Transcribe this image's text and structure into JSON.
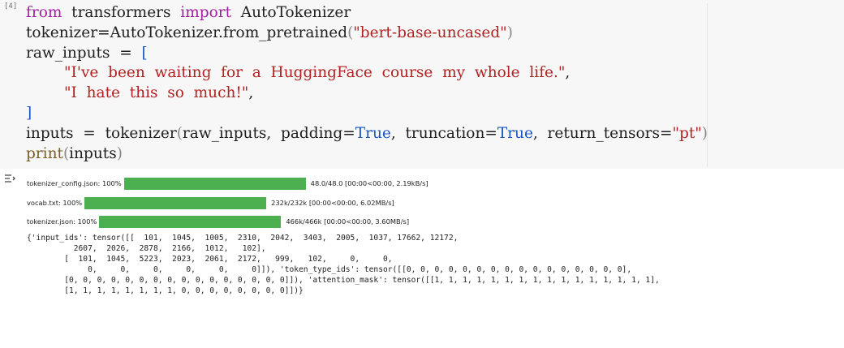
{
  "cell": {
    "execution_count": "[4]",
    "code": {
      "line1": {
        "from": "from",
        "module": "transformers",
        "import": "import",
        "name": "AutoTokenizer"
      },
      "line2": {
        "lhs": "tokenizer=AutoTokenizer.from_pretrained",
        "arg": "\"bert-base-uncased\""
      },
      "line3": {
        "lhs": "raw_inputs",
        "eq": "=",
        "bracket": "["
      },
      "line4": {
        "str": "\"I've  been  waiting  for  a  HuggingFace  course  my  whole  life.\"",
        "comma": ","
      },
      "line5": {
        "str": "\"I  hate  this  so  much!\"",
        "comma": ","
      },
      "line6": {
        "bracket": "]"
      },
      "line7": {
        "lhs": "inputs",
        "eq": "=",
        "call": "tokenizer",
        "args_a": "raw_inputs,  padding=",
        "true1": "True",
        "args_b": ",  truncation=",
        "true2": "True",
        "args_c": ",  return_tensors=",
        "pt": "\"pt\""
      },
      "line8": {
        "fn": "print",
        "arg": "inputs"
      }
    }
  },
  "output": {
    "icon": "output-toggle-icon",
    "progress_bars": [
      {
        "desc": "tokenizer_config.json: 100%",
        "stats": "48.0/48.0 [00:00<00:00, 2.19kB/s]",
        "progress": 1.0
      },
      {
        "desc": "vocab.txt: 100%",
        "stats": "232k/232k [00:00<00:00, 6.02MB/s]",
        "progress": 1.0
      },
      {
        "desc": "tokenizer.json: 100%",
        "stats": "466k/466k [00:00<00:00, 3.60MB/s]",
        "progress": 1.0
      }
    ],
    "text": "{'input_ids': tensor([[  101,  1045,  1005,  2310,  2042,  3403,  2005,  1037, 17662, 12172,\n          2607,  2026,  2878,  2166,  1012,   102],\n        [  101,  1045,  5223,  2023,  2061,  2172,   999,   102,     0,     0,\n             0,     0,     0,     0,     0,     0]]), 'token_type_ids': tensor([[0, 0, 0, 0, 0, 0, 0, 0, 0, 0, 0, 0, 0, 0, 0, 0],\n        [0, 0, 0, 0, 0, 0, 0, 0, 0, 0, 0, 0, 0, 0, 0, 0]]), 'attention_mask': tensor([[1, 1, 1, 1, 1, 1, 1, 1, 1, 1, 1, 1, 1, 1, 1, 1],\n        [1, 1, 1, 1, 1, 1, 1, 1, 0, 0, 0, 0, 0, 0, 0, 0]])}"
  },
  "colors": {
    "keyword": "#a020a0",
    "string": "#b22222",
    "literal": "#1a56c4",
    "progress": "#4caf50",
    "cell_bg": "#f7f7f7"
  }
}
